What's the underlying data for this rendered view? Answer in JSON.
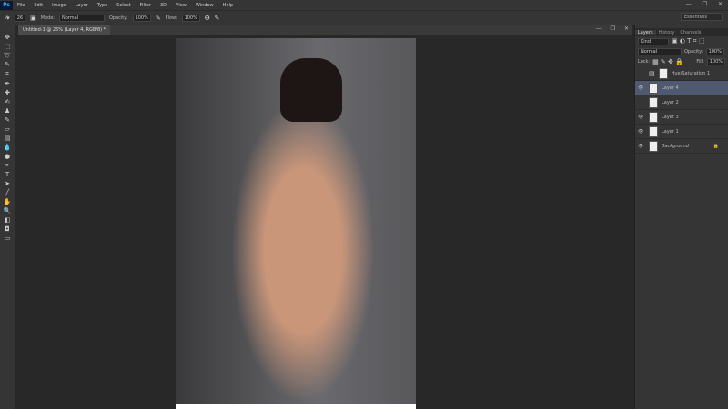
{
  "app": {
    "logo": "Ps"
  },
  "menu": [
    "File",
    "Edit",
    "Image",
    "Layer",
    "Type",
    "Select",
    "Filter",
    "3D",
    "View",
    "Window",
    "Help"
  ],
  "window_controls": [
    "—",
    "❐",
    "✕"
  ],
  "options": {
    "brush_size": "26",
    "mode_label": "Mode:",
    "mode_value": "Normal",
    "opacity_label": "Opacity:",
    "opacity_value": "100%",
    "flow_label": "Flow:",
    "flow_value": "100%"
  },
  "workspace": "Essentials",
  "document": {
    "tab": "Untitled-1 @ 25% (Layer 4, RGB/8) *"
  },
  "panel": {
    "tabs": [
      "Layers",
      "History",
      "Channels"
    ],
    "filter_kind": "Kind",
    "blend": "Normal",
    "opacity_label": "Opacity:",
    "opacity": "100%",
    "lock_label": "Lock:",
    "fill_label": "Fill:",
    "fill": "100%",
    "layers": [
      {
        "name": "Hue/Saturation 1",
        "visible": false,
        "selected": false
      },
      {
        "name": "Layer 4",
        "visible": true,
        "selected": true
      },
      {
        "name": "Layer 2",
        "visible": false,
        "selected": false
      },
      {
        "name": "Layer 3",
        "visible": true,
        "selected": false
      },
      {
        "name": "Layer 1",
        "visible": true,
        "selected": false
      },
      {
        "name": "Background",
        "visible": true,
        "selected": false,
        "locked": true
      }
    ]
  }
}
